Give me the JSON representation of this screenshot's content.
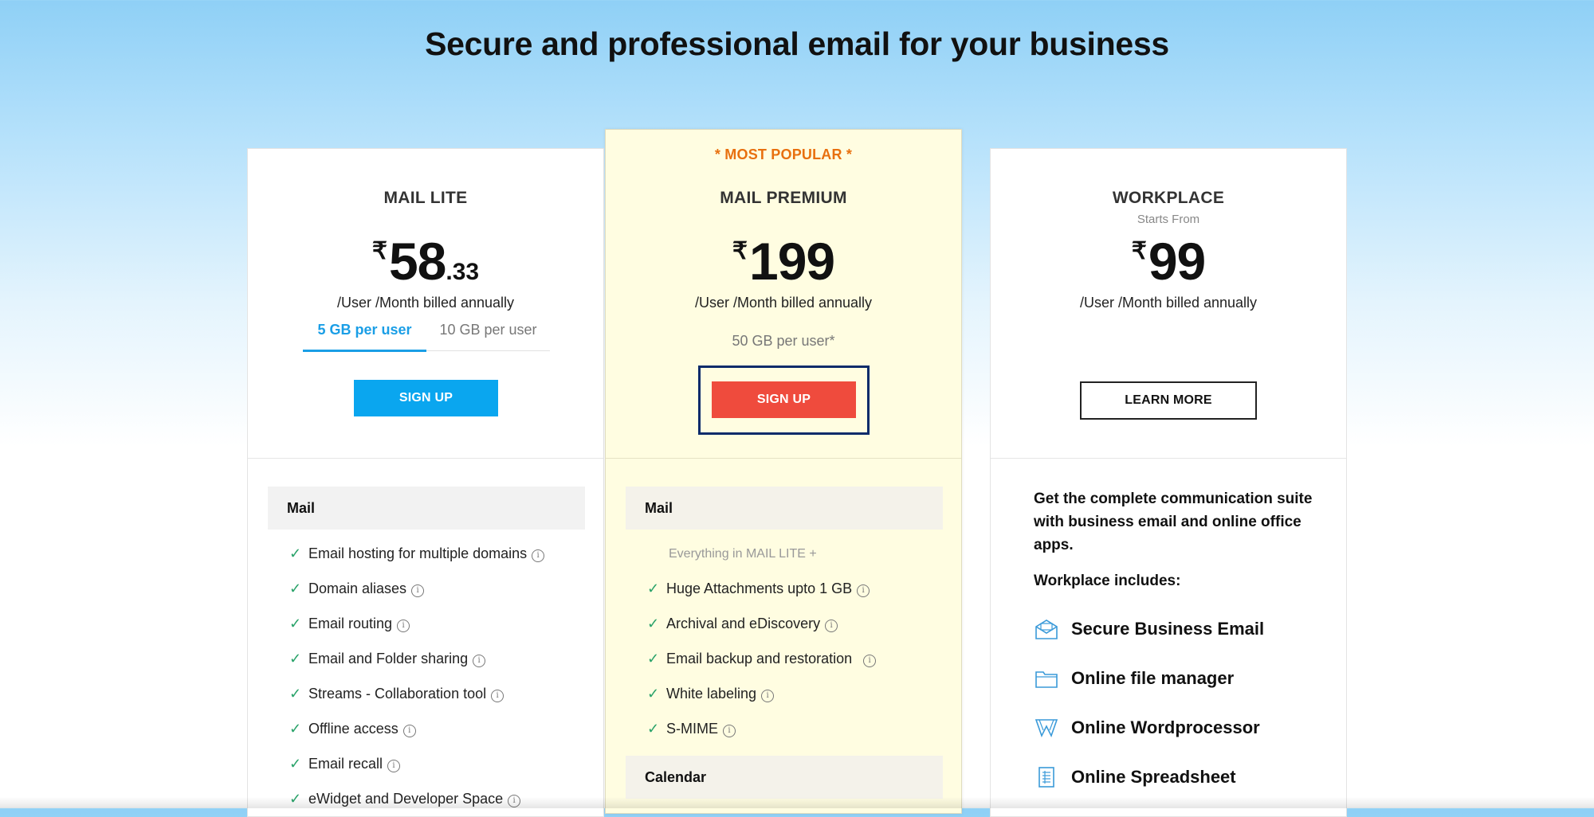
{
  "headline": "Secure and professional email for your business",
  "plans": {
    "lite": {
      "name": "MAIL LITE",
      "currency": "₹",
      "price_main": "58",
      "price_decimal": ".33",
      "billed": "/User /Month billed annually",
      "storage_tabs": [
        "5 GB per user",
        "10 GB per user"
      ],
      "storage_selected": "5 GB per user",
      "button": "SIGN UP",
      "section": "Mail",
      "features": [
        "Email hosting for multiple domains",
        "Domain aliases",
        "Email routing",
        "Email and Folder sharing",
        "Streams - Collaboration tool",
        "Offline access",
        "Email recall",
        "eWidget and Developer Space"
      ]
    },
    "premium": {
      "badge": "* MOST POPULAR *",
      "name": "MAIL PREMIUM",
      "currency": "₹",
      "price_main": "199",
      "billed": "/User /Month billed annually",
      "storage": "50 GB per user*",
      "button": "SIGN UP",
      "section": "Mail",
      "everything": "Everything in MAIL LITE +",
      "features": [
        "Huge Attachments upto 1 GB",
        "Archival and eDiscovery",
        "Email backup and restoration",
        "White labeling",
        "S-MIME"
      ],
      "section2": "Calendar"
    },
    "workplace": {
      "name": "WORKPLACE",
      "starts_from": "Starts From",
      "currency": "₹",
      "price_main": "99",
      "billed": "/User /Month billed annually",
      "button": "LEARN MORE",
      "description": "Get the complete communication suite with business email and online office apps.",
      "includes_title": "Workplace includes:",
      "includes": [
        {
          "label": "Secure Business Email",
          "icon": "mail-envelope-icon"
        },
        {
          "label": "Online file manager",
          "icon": "folder-icon"
        },
        {
          "label": "Online Wordprocessor",
          "icon": "writer-icon"
        },
        {
          "label": "Online Spreadsheet",
          "icon": "spreadsheet-icon"
        }
      ]
    }
  },
  "colors": {
    "accent_blue": "#0aa6ef",
    "signup_red": "#ef4b3d",
    "popular_orange": "#e8700f",
    "check_green": "#2aa36a",
    "premium_bg": "#fffde1"
  }
}
